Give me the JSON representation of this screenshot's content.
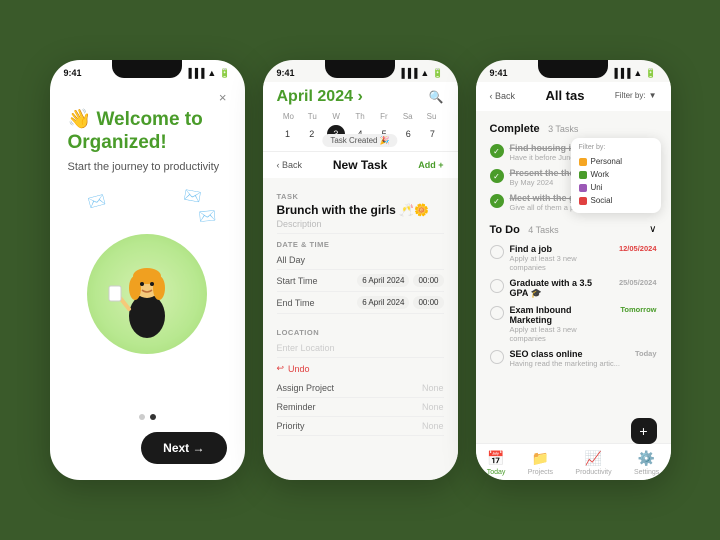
{
  "app": {
    "background_color": "#3a5a2a"
  },
  "phone1": {
    "status_time": "9:41",
    "close_label": "×",
    "welcome_emoji": "👋",
    "title_line1": "Welcome to",
    "title_highlight": "Organized!",
    "subtitle": "Start the journey to productivity",
    "next_label": "Next →",
    "dots": [
      "inactive",
      "active"
    ]
  },
  "phone2": {
    "status_time": "9:41",
    "month": "April",
    "year": "2024",
    "arrow": "›",
    "task_badge_label": "Task Created 🎉",
    "days_header": [
      "Mo",
      "Tu",
      "W",
      "Th",
      "Fr",
      "Sa",
      "Su"
    ],
    "days": [
      "1",
      "2",
      "3",
      "4",
      "5",
      "6",
      "7"
    ],
    "today": "3",
    "back_label": "‹ Back",
    "nav_title": "New Task",
    "add_label": "Add +",
    "form": {
      "task_label": "TASK",
      "task_name": "Brunch with the girls 🥂🌼",
      "desc_placeholder": "Description",
      "datetime_label": "DATE & TIME",
      "allday_label": "All Day",
      "start_label": "Start Time",
      "start_date": "6 April 2024",
      "start_time": "00:00",
      "end_label": "End Time",
      "end_date": "6 April 2024",
      "end_time": "00:00",
      "location_label": "LOCATION",
      "location_placeholder": "Enter Location",
      "undo_label": "Undo",
      "assign_label": "Assign Project",
      "assign_value": "None",
      "reminder_label": "Reminder",
      "reminder_value": "None",
      "priority_label": "Priority",
      "priority_value": "None"
    }
  },
  "phone3": {
    "status_time": "9:41",
    "back_label": "‹ Back",
    "title": "All tas",
    "filter_label": "Filter by:",
    "filter_options": [
      {
        "label": "Personal",
        "color": "#f5a623"
      },
      {
        "label": "Work",
        "color": "#4a9c2a"
      },
      {
        "label": "Uni",
        "color": "#9b59b6"
      },
      {
        "label": "Social",
        "color": "#e04040"
      }
    ],
    "complete_section": {
      "title": "Complete",
      "count": "3 Tasks",
      "tasks": [
        {
          "text": "Find housing in Swe",
          "sub": "Have it before June 20",
          "done": true
        },
        {
          "text": "Present the thesis",
          "sub": "By May 2024",
          "done": true
        },
        {
          "text": "Meet with the girls to say bye",
          "sub": "Give all of them a present",
          "done": true
        }
      ]
    },
    "todo_section": {
      "title": "To Do",
      "count": "4 Tasks",
      "tasks": [
        {
          "text": "Find a job",
          "sub": "Apply at least 3 new companies",
          "date": "12/05/2024",
          "date_color": "red"
        },
        {
          "text": "Graduate with a 3.5 GPA 🎓",
          "sub": "",
          "date": "25/05/2024",
          "date_color": "gray"
        },
        {
          "text": "Exam Inbound Marketing",
          "sub": "Apply at least 3 new companies",
          "date": "Tomorrow",
          "date_color": "green"
        },
        {
          "text": "SEO class online",
          "sub": "Having read the marketing artic...",
          "date": "Today",
          "date_color": "gray"
        }
      ]
    },
    "nav_items": [
      {
        "label": "Today",
        "icon": "📅",
        "active": true
      },
      {
        "label": "Projects",
        "icon": "📁",
        "active": false
      },
      {
        "label": "Productivity",
        "icon": "📈",
        "active": false
      },
      {
        "label": "Settings",
        "icon": "⚙️",
        "active": false
      }
    ],
    "fab_label": "+"
  }
}
